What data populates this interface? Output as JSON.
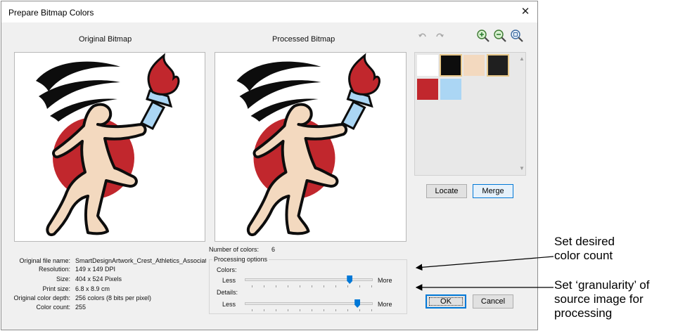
{
  "dialog": {
    "title": "Prepare Bitmap Colors",
    "close_icon": "close-icon"
  },
  "captions": {
    "original": "Original Bitmap",
    "processed": "Processed Bitmap"
  },
  "toolbar": {
    "undo_icon": "undo-icon",
    "redo_icon": "redo-icon",
    "zoom_in_icon": "zoom-in-icon",
    "zoom_out_icon": "zoom-out-icon",
    "zoom_fit_icon": "zoom-fit-icon"
  },
  "palette": {
    "swatches": [
      {
        "color": "#ffffff",
        "selected": false
      },
      {
        "color": "#0d0d0d",
        "selected": true
      },
      {
        "color": "#f3d9bf",
        "selected": false
      },
      {
        "color": "#1f1f1f",
        "selected": true
      },
      {
        "color": "#c1272d",
        "selected": false
      },
      {
        "color": "#abd6f4",
        "selected": false
      }
    ]
  },
  "buttons": {
    "locate": "Locate",
    "merge": "Merge",
    "ok": "OK",
    "cancel": "Cancel"
  },
  "info": {
    "file_name_label": "Original file name:",
    "file_name_value": "SmartDesignArtwork_Crest_Athletics_Associatio",
    "resolution_label": "Resolution:",
    "resolution_value": "149 x 149 DPI",
    "size_label": "Size:",
    "size_value": "404 x 524 Pixels",
    "print_size_label": "Print size:",
    "print_size_value": "6.8 x 8.9 cm",
    "color_depth_label": "Original color depth:",
    "color_depth_value": "256 colors (8 bits per pixel)",
    "color_count_label": "Color count:",
    "color_count_value": "255"
  },
  "processing": {
    "num_colors_label": "Number of colors:",
    "num_colors_value": "6",
    "group_title": "Processing options",
    "colors_label": "Colors:",
    "details_label": "Details:",
    "less": "Less",
    "more": "More",
    "colors_level": 0.82,
    "details_level": 0.88
  },
  "annotations": {
    "color_count": [
      "Set desired",
      "color count"
    ],
    "granularity": [
      "Set ‘granularity’ of",
      "source image for",
      "processing"
    ]
  },
  "colors": {
    "accent": "#0078d7",
    "runner_skin": "#f3d9bf",
    "sun_red": "#c1272d",
    "torch_handle": "#abd6f4",
    "outline": "#0d0d0d"
  }
}
